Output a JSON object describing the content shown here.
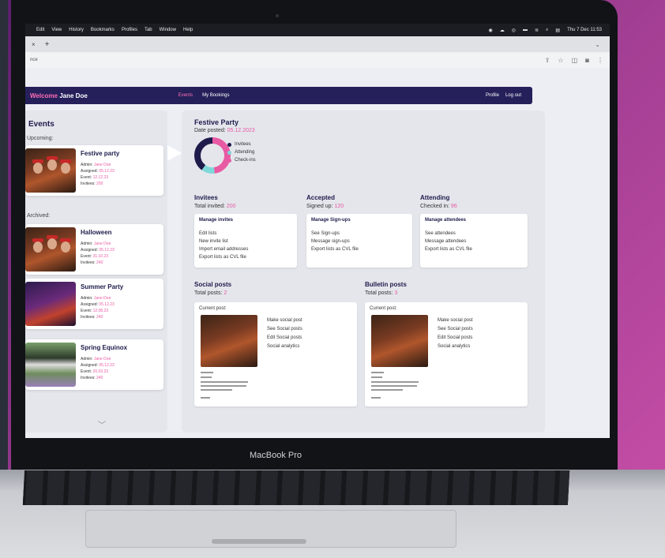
{
  "device": {
    "label": "MacBook Pro"
  },
  "menubar": {
    "items": [
      "Edit",
      "View",
      "History",
      "Bookmarks",
      "Profiles",
      "Tab",
      "Window",
      "Help"
    ],
    "clock": "Thu 7 Dec 11:53"
  },
  "browser": {
    "tab_close": "×",
    "tab_new": "+",
    "url": "nce"
  },
  "app": {
    "welcome": "Welcome",
    "user_name": "Jane Doe",
    "nav": {
      "events": "Events",
      "bookings": "My Bookings",
      "profile": "Profile",
      "logout": "Log out"
    }
  },
  "sidebar": {
    "title": "Events",
    "upcoming_label": "Upcoming:",
    "archived_label": "Archived:",
    "events": [
      {
        "title": "Festive party",
        "admin": "Jane Doe",
        "assigned": "05.12.23",
        "event": "12.12.23",
        "invitees": "200"
      },
      {
        "title": "Halloween",
        "admin": "Jane Doe",
        "assigned": "05.12.23",
        "event": "31.10.23",
        "invitees": "240"
      },
      {
        "title": "Summer Party",
        "admin": "Jane Doe",
        "assigned": "05.12.23",
        "event": "12.08.23",
        "invitees": "240"
      },
      {
        "title": "Spring Equinox",
        "admin": "Jane Doe",
        "assigned": "05.12.23",
        "event": "20.03.23",
        "invitees": "240"
      }
    ],
    "meta_labels": {
      "admin": "Admin:",
      "assigned": "Assigned:",
      "event": "Event:",
      "invitees": "Invitees:"
    }
  },
  "detail": {
    "title": "Festive Party",
    "date_posted_label": "Date posted:",
    "date_posted": "05.12.2023",
    "legend": [
      "Invitees",
      "Attending",
      "Check-ins"
    ],
    "colors": {
      "invitees": "#1e1b4b",
      "attending": "#7fd8d8",
      "checkins": "#e85aa3"
    },
    "donut": {
      "invitees": 200,
      "attending": 120,
      "checkins": 96
    },
    "invitees": {
      "heading": "Invitees",
      "total_label": "Total invited:",
      "total": "200",
      "box_title": "Manage invites",
      "links": [
        "Edit lists",
        "New invite list",
        "Import email addresses",
        "Export lists as CVL file"
      ]
    },
    "accepted": {
      "heading": "Accepted",
      "total_label": "Signed up:",
      "total": "120",
      "box_title": "Manage Sign-ups",
      "links": [
        "See Sign-ups",
        "Message sign-ups",
        "Export lists as CVL file"
      ]
    },
    "attending": {
      "heading": "Attending",
      "total_label": "Checked in:",
      "total": "96",
      "box_title": "Manage attendees",
      "links": [
        "See attendees",
        "Message attendees",
        "Export lists as CVL file"
      ]
    },
    "social": {
      "heading": "Social posts",
      "total_label": "Total posts:",
      "total": "2",
      "current_label": "Current post:",
      "actions": [
        "Make social post",
        "See Social posts",
        "Edit Social posts",
        "Social analytics"
      ]
    },
    "bulletin": {
      "heading": "Bulletin posts",
      "total_label": "Total posts:",
      "total": "3",
      "current_label": "Current post:",
      "actions": [
        "Make social post",
        "See Social posts",
        "Edit Social posts",
        "Social analytics"
      ]
    }
  }
}
